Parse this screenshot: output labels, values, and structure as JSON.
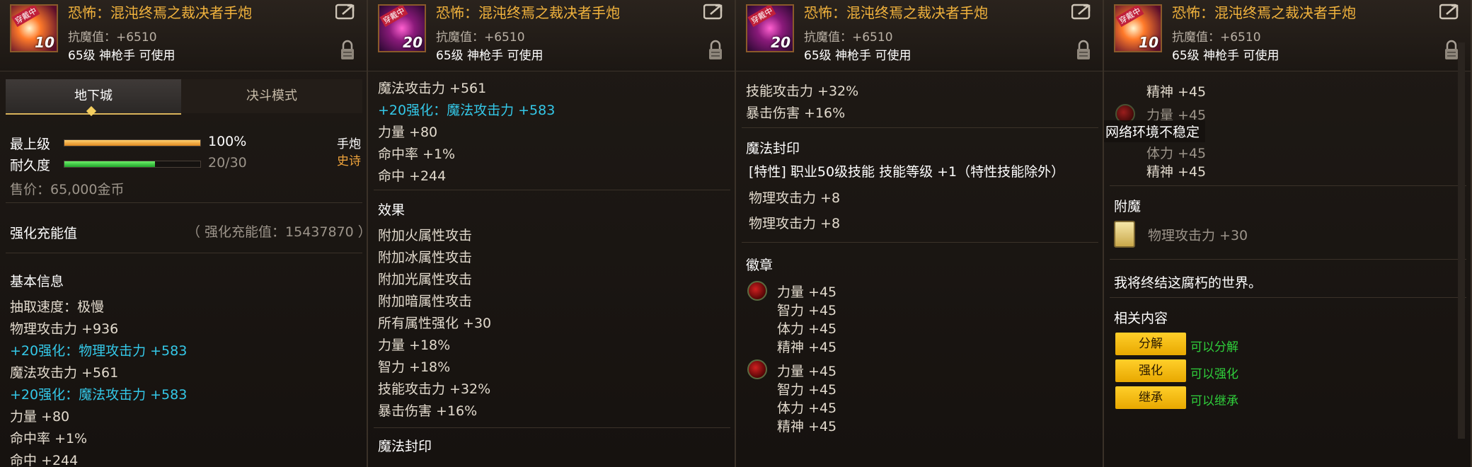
{
  "item": {
    "name": "恐怖：混沌终焉之裁决者手炮",
    "resist": "抗魔值：+6510",
    "requirement": "65级 神枪手 可使用",
    "icon_level": "20",
    "icon_level_p1": "10",
    "icon_tag": "穿戴中"
  },
  "icons": [
    "item-icon",
    "share-icon",
    "lock-icon",
    "orb-icon",
    "card-icon"
  ],
  "colors": {
    "title": "#f2b33d",
    "cyan": "#34c8e8",
    "button": "#ffcf2a",
    "green": "#2fcf3b"
  },
  "panel1": {
    "tabs": [
      "地下城",
      "决斗模式"
    ],
    "grade_label": "最上级",
    "grade_pct": "100%",
    "grade_value": 1.0,
    "type": "手炮",
    "durability_label": "耐久度",
    "durability_value": "20/30",
    "durability_ratio": 0.667,
    "rarity": "史诗",
    "price": "售价：65,000金币",
    "charge_label": "强化充能值",
    "charge_value": "（ 强化充能值：15437870 ）",
    "basic_title": "基本信息",
    "lines": [
      "抽取速度：极慢",
      "物理攻击力 +936",
      "+20强化：物理攻击力 +583",
      "魔法攻击力 +561",
      "+20强化：魔法攻击力 +583",
      "力量 +80",
      "命中率 +1%",
      "命中 +244"
    ]
  },
  "panel2": {
    "lines_top": [
      "魔法攻击力 +561",
      "+20强化：魔法攻击力 +583",
      "力量 +80",
      "命中率 +1%",
      "命中 +244"
    ],
    "effect_title": "效果",
    "effects": [
      "附加火属性攻击",
      "附加冰属性攻击",
      "附加光属性攻击",
      "附加暗属性攻击",
      "所有属性强化 +30",
      "力量 +18%",
      "智力 +18%",
      "技能攻击力 +32%",
      "暴击伤害 +16%"
    ],
    "seal_title": "魔法封印"
  },
  "panel3": {
    "lines_top": [
      "技能攻击力 +32%",
      "暴击伤害 +16%"
    ],
    "seal_title": "魔法封印",
    "seal_special": "[特性] 职业50级技能 技能等级 +1（特性技能除外）",
    "seal_lines": [
      "物理攻击力 +8",
      "物理攻击力 +8"
    ],
    "emblem_title": "徽章",
    "emblem1": [
      "力量 +45",
      "智力 +45",
      "体力 +45",
      "精神 +45"
    ],
    "emblem2": [
      "力量 +45",
      "智力 +45",
      "体力 +45",
      "精神 +45"
    ]
  },
  "panel4": {
    "top_lines": [
      "精神 +45",
      "力量 +45",
      "体力 +45",
      "精神 +45"
    ],
    "network_msg": "网络环境不稳定",
    "enchant_title": "附魔",
    "enchant_value": "物理攻击力 +30",
    "flavor": "我将终结这腐朽的世界。",
    "related_title": "相关内容",
    "buttons": [
      {
        "label": "分解",
        "desc": "可以分解"
      },
      {
        "label": "强化",
        "desc": "可以强化"
      },
      {
        "label": "继承",
        "desc": "可以继承"
      }
    ]
  }
}
